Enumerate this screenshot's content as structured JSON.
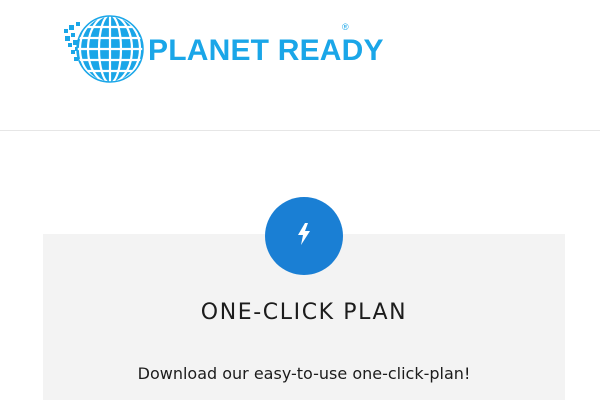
{
  "header": {
    "logo": {
      "icon": "globe-icon",
      "text": "PLANET READY",
      "registered_mark": "®",
      "brand_color": "#1aa6e8"
    }
  },
  "card": {
    "icon": "lightning-bolt-icon",
    "icon_bg_color": "#1a7fd4",
    "title": "ONE-CLICK PLAN",
    "description": "Download our easy-to-use one-click-plan!"
  }
}
